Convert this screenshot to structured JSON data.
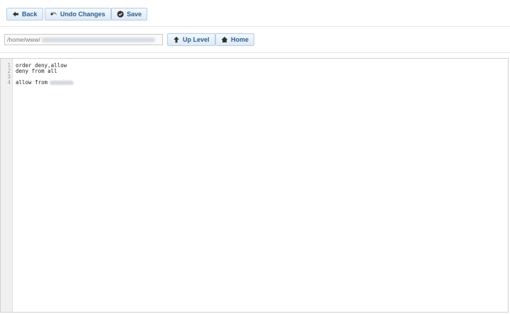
{
  "toolbar": {
    "back_label": "Back",
    "undo_label": "Undo Changes",
    "save_label": "Save"
  },
  "pathbar": {
    "path_value": "/home/www/",
    "up_label": "Up Level",
    "home_label": "Home"
  },
  "editor": {
    "line_numbers": [
      "1",
      "2",
      "3",
      "4"
    ],
    "lines": [
      "order deny,allow",
      "deny from all",
      "",
      "allow from"
    ]
  },
  "icons": {
    "back": "arrow-left-icon",
    "undo": "undo-icon",
    "save": "check-circle-icon",
    "up": "arrow-up-icon",
    "home": "home-icon"
  },
  "colors": {
    "button_text": "#2f5e8c",
    "button_border": "#b7cde4",
    "gutter_bg": "#f0f0f0"
  }
}
